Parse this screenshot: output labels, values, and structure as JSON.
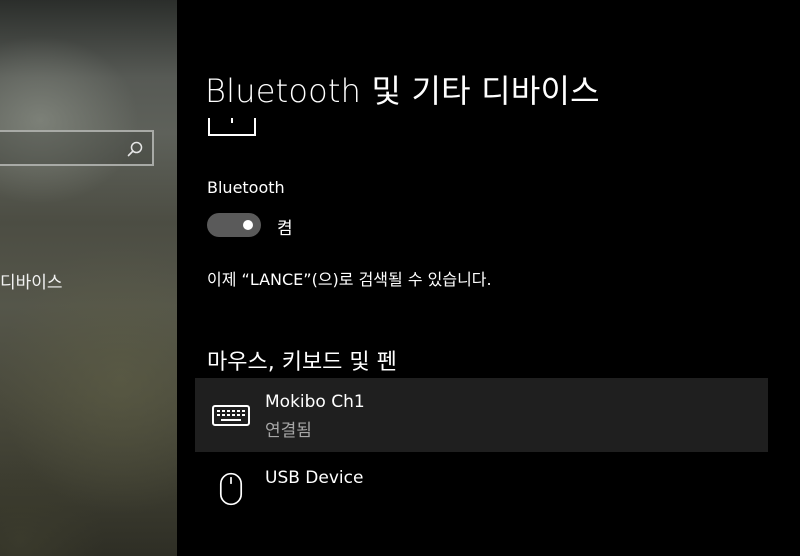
{
  "sidebar": {
    "search": {
      "value": "",
      "placeholder": ""
    },
    "nav_item_label": "디바이스"
  },
  "page": {
    "title": "Bluetooth 및 기타 디바이스"
  },
  "bluetooth": {
    "label": "Bluetooth",
    "toggle_state_label": "켬",
    "toggle_on": true,
    "discoverable_text": "이제 “LANCE”(으)로 검색될 수 있습니다."
  },
  "section": {
    "heading": "마우스, 키보드 및 펜"
  },
  "devices": [
    {
      "name": "Mokibo Ch1",
      "status": "연결됨",
      "icon": "keyboard-icon"
    },
    {
      "name": "USB Device",
      "status": "",
      "icon": "mouse-icon"
    }
  ],
  "colors": {
    "background": "#000000",
    "selected_item_bg": "#1f1f1f",
    "toggle_track": "#5a5a5a",
    "secondary_text": "#a6a6a6"
  }
}
